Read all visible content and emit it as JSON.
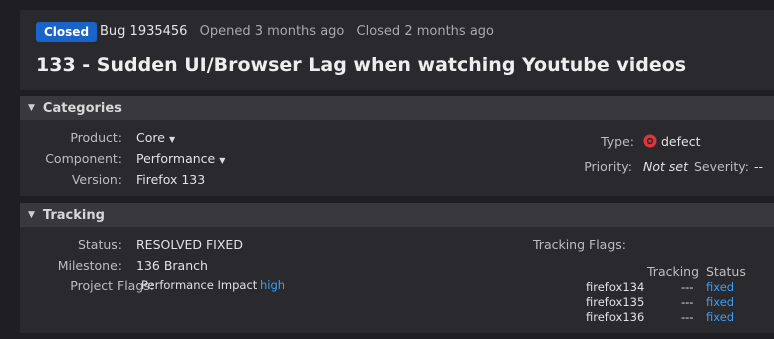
{
  "header": {
    "status": "Closed",
    "bug_id": "Bug 1935456",
    "opened": "Opened 3 months ago",
    "closed": "Closed 2 months ago",
    "title": "133 - Sudden UI/Browser Lag when watching Youtube videos"
  },
  "categories": {
    "heading": "Categories",
    "product_label": "Product:",
    "product_value": "Core",
    "component_label": "Component:",
    "component_value": "Performance",
    "version_label": "Version:",
    "version_value": "Firefox 133",
    "type_label": "Type:",
    "type_value": "defect",
    "priority_label": "Priority:",
    "priority_value": "Not set",
    "severity_label": "Severity:",
    "severity_value": "--"
  },
  "tracking": {
    "heading": "Tracking",
    "status_label": "Status:",
    "status_value": "RESOLVED FIXED",
    "milestone_label": "Milestone:",
    "milestone_value": "136 Branch",
    "project_flags_label": "Project Flags:",
    "project_flag_name": "Performance Impact",
    "project_flag_value": "high",
    "tracking_flags_label": "Tracking Flags:",
    "col_tracking": "Tracking",
    "col_status": "Status",
    "rows": [
      {
        "flag": "firefox134",
        "tracking": "---",
        "status": "fixed"
      },
      {
        "flag": "firefox135",
        "tracking": "---",
        "status": "fixed"
      },
      {
        "flag": "firefox136",
        "tracking": "---",
        "status": "fixed"
      }
    ]
  },
  "colors": {
    "badge": "#1a64c9",
    "link": "#3d9df3",
    "defect_icon": "#e2353a"
  },
  "icons": {
    "collapse": "chevron-down-icon",
    "defect": "bug-defect-icon"
  }
}
